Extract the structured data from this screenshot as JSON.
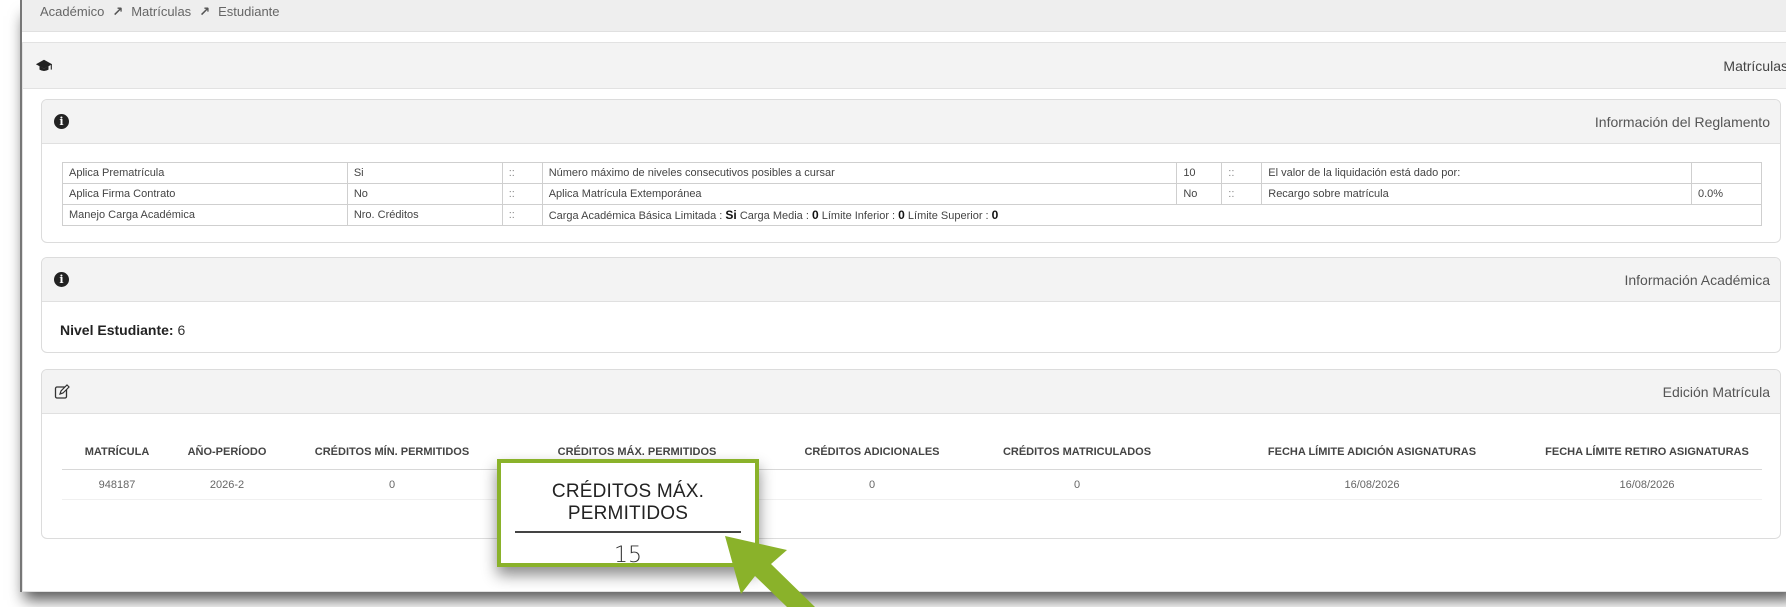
{
  "breadcrumb": [
    "Académico",
    "Matrículas",
    "Estudiante"
  ],
  "outer_title": "Matrículas",
  "reglamento": {
    "title": "Información del Reglamento",
    "rows": [
      [
        "Aplica Prematrícula",
        "Si",
        "::",
        "Número máximo de niveles consecutivos posibles a cursar",
        "10",
        "::",
        "El valor de la liquidación está dado por:",
        ""
      ],
      [
        "Aplica Firma Contrato",
        "No",
        "::",
        "Aplica Matrícula Extemporánea",
        "No",
        "::",
        "Recargo sobre matrícula",
        "0.0%"
      ]
    ],
    "row3": {
      "label": "Manejo Carga Académica",
      "value": "Nro. Créditos",
      "sep": "::",
      "basica_label": "Carga Académica Básica Limitada :",
      "basica_value": "Si",
      "media_label": "Carga Media :",
      "media_value": "0",
      "inferior_label": "Límite Inferior :",
      "inferior_value": "0",
      "superior_label": "Límite Superior :",
      "superior_value": "0"
    }
  },
  "academica": {
    "title": "Información Académica",
    "nivel_label": "Nivel Estudiante:",
    "nivel_value": "6"
  },
  "edicion": {
    "title": "Edición Matrícula",
    "headers": [
      "MATRÍCULA",
      "AÑO-PERÍODO",
      "CRÉDITOS MÍN. PERMITIDOS",
      "CRÉDITOS MÁX. PERMITIDOS",
      "CRÉDITOS ADICIONALES",
      "CRÉDITOS MATRICULADOS",
      "FECHA LÍMITE ADICIÓN ASIGNATURAS",
      "FECHA LÍMITE RETIRO ASIGNATURAS"
    ],
    "values": [
      "948187",
      "2026-2",
      "0",
      "15",
      "0",
      "0",
      "16/08/2026",
      "16/08/2026"
    ]
  },
  "callout": {
    "header": "CRÉDITOS MÁX. PERMITIDOS",
    "value": "15"
  },
  "colors": {
    "callout_border": "#8ab22a",
    "arrow": "#8ab22a"
  }
}
